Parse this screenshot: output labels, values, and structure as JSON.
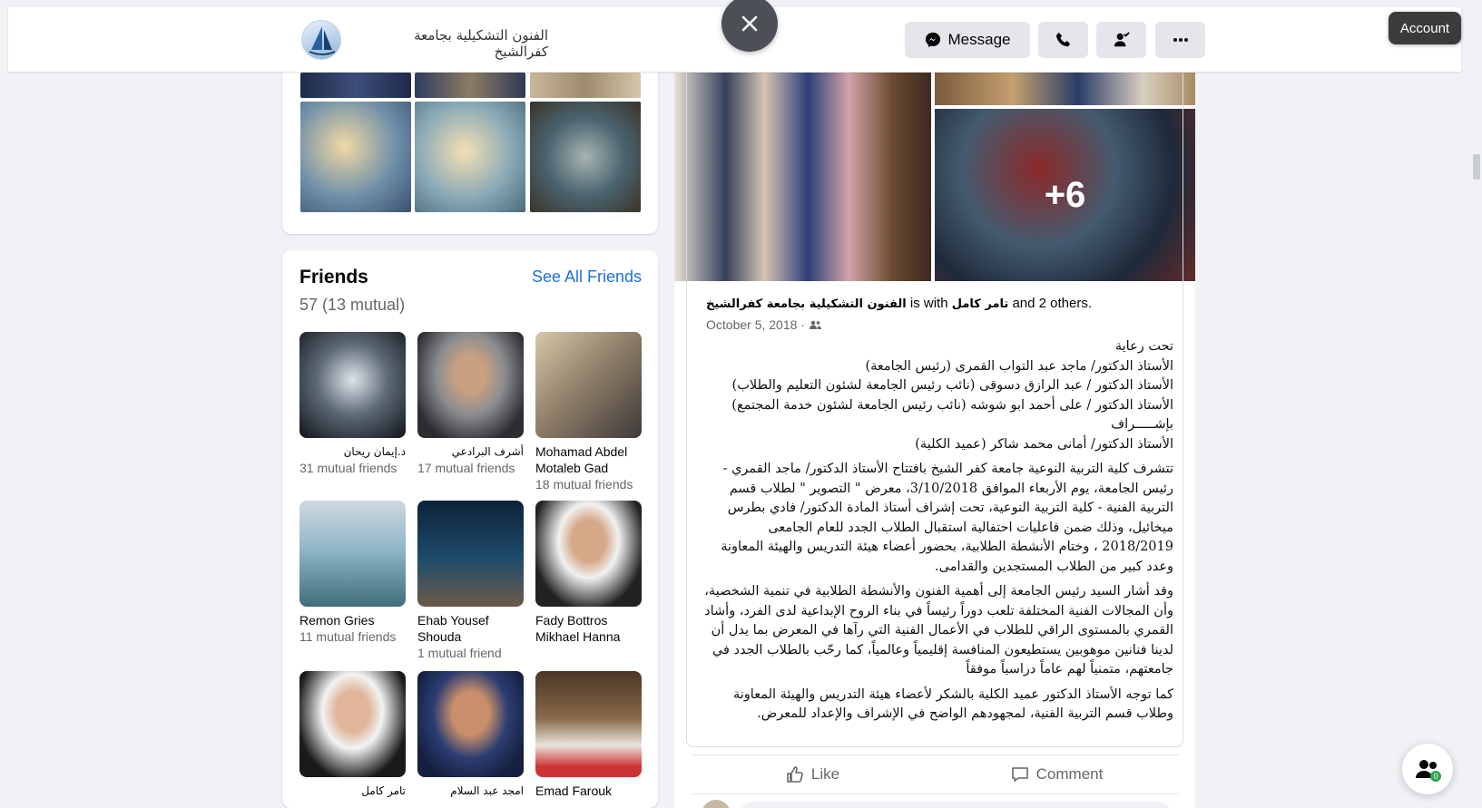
{
  "header": {
    "page_name": "الفنون التشكيلية بجامعة كفرالشيخ",
    "message_label": "Message",
    "account_label": "Account",
    "icons": [
      "messenger-icon",
      "phone-icon",
      "friend-icon",
      "more-icon",
      "close-icon"
    ]
  },
  "friends": {
    "title": "Friends",
    "see_all": "See All Friends",
    "count": "57 (13 mutual)",
    "items": [
      {
        "name": "د.إيمان ريحان",
        "mutual": "31 mutual friends",
        "rtl": true
      },
      {
        "name": "أشرف البرادعي",
        "mutual": "17 mutual friends",
        "rtl": true
      },
      {
        "name": "Mohamad Abdel Motaleb Gad",
        "mutual": "18 mutual friends",
        "rtl": false
      },
      {
        "name": "Remon Gries",
        "mutual": "11 mutual friends",
        "rtl": false
      },
      {
        "name": "Ehab Yousef Shouda",
        "mutual": "1 mutual friend",
        "rtl": false
      },
      {
        "name": "Fady Bottros Mikhael Hanna",
        "mutual": "",
        "rtl": false
      },
      {
        "name": "تامر كامل",
        "mutual": "",
        "rtl": true
      },
      {
        "name": "امجد عبد السلام",
        "mutual": "",
        "rtl": true
      },
      {
        "name": "Emad Farouk",
        "mutual": "",
        "rtl": false
      }
    ]
  },
  "post": {
    "author": "الفنون التشكيلية بجامعة كفرالشيخ",
    "with_text": "is with",
    "tagged": "تامر كامل",
    "and_others": "and 2 others.",
    "date": "October 5, 2018 ·",
    "more_photos": "+6",
    "body": [
      "تحت رعاية",
      "الأستاذ الدكتور/ ماجد عبد التواب القمرى     (رئيس الجامعة)",
      "الأستاذ الدكتور / عبد الرازق دسوقى  (نائب رئيس الجامعة لشئون التعليم والطلاب)",
      "الأستاذ الدكتور / على أحمد ابو شوشه (نائب رئيس الجامعة لشئون خدمة المجتمع)",
      "بإشـــــراف",
      "الأستاذ الدكتور/ أمانى محمد شاكر          (عميد الكلية)",
      "تتشرف كلية التربية النوعية جامعة كفر الشيخ بافتتاح الأستاذ الدكتور/ ماجد القمري - رئيس الجامعة، يوم الأربعاء الموافق 3/10/2018، معرض \" التصوير \" لطلاب قسم التربية الفنية - كلية التربية النوعية، تحت إشراف أستاذ المادة الدكتور/ فادي بطرس ميخائيل، وذلك ضمن فاعليات احتفالية استقبال الطلاب الجدد للعام الجامعى 2018/2019 ، وختام الأنشطة الطلابية، بحضور أعضاء هيئة التدريس والهيئة المعاونة وعدد كبير من الطلاب المستجدين والقدامى.",
      "وقد أشار السيد رئيس الجامعة إلى أهمية الفنون والأنشطة الطلابية في تنمية الشخصية، وأن المجالات الفنية المختلفة تلعب دوراً رئيساً في بناء الروح الإبداعية لدى الفرد، وأشاد القمري بالمستوى الراقي للطلاب في الأعمال الفنية التي رآها في المعرض بما يدل أن لدينا فنانين موهوبين يستطيعون المنافسة إقليمياً وعالمياً، كما رحّب بالطلاب الجدد في جامعتهم، متمنياً لهم عاماً دراسياً موفقاً",
      "كما توجه الأستاذ الدكتور عميد الكلية بالشكر لأعضاء هيئة التدريس والهيئة المعاونة وطلاب قسم التربية الفنية، لمجهودهم الواضح في الإشراف والإعداد للمعرض."
    ],
    "like_label": "Like",
    "comment_label": "Comment"
  },
  "contacts_badge": "0"
}
